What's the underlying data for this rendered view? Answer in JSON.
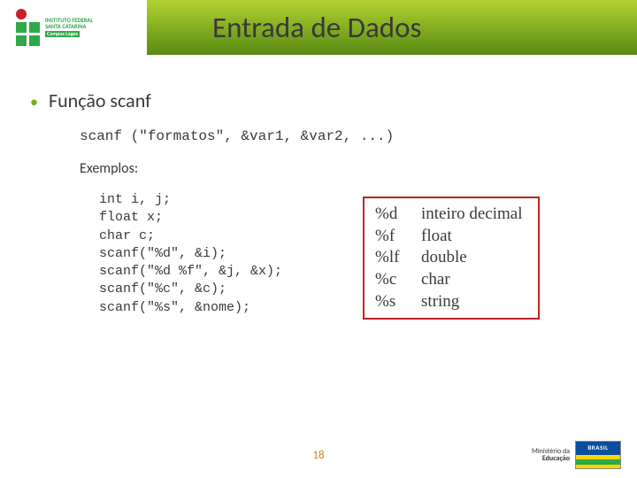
{
  "header": {
    "title": "Entrada de Dados",
    "logo": {
      "line1": "INSTITUTO FEDERAL",
      "line2": "SANTA CATARINA",
      "line3": "Campus Lages"
    }
  },
  "bullet": {
    "label": "Função scanf"
  },
  "syntax": {
    "code": "scanf (\"formatos\", &var1, &var2, ...)"
  },
  "examples": {
    "label": "Exemplos:",
    "code": "int i, j;\nfloat x;\nchar c;\nscanf(\"%d\", &i);\nscanf(\"%d %f\", &j, &x);\nscanf(\"%c\", &c);\nscanf(\"%s\", &nome);"
  },
  "format_table": [
    {
      "code": "%d",
      "desc": "inteiro decimal"
    },
    {
      "code": "%f",
      "desc": "float"
    },
    {
      "code": "%lf",
      "desc": "double"
    },
    {
      "code": "%c",
      "desc": "char"
    },
    {
      "code": "%s",
      "desc": "string"
    }
  ],
  "footer": {
    "page": "18",
    "ministry_line1": "Ministério da",
    "ministry_line2": "Educação",
    "brasil": "BRASIL"
  }
}
